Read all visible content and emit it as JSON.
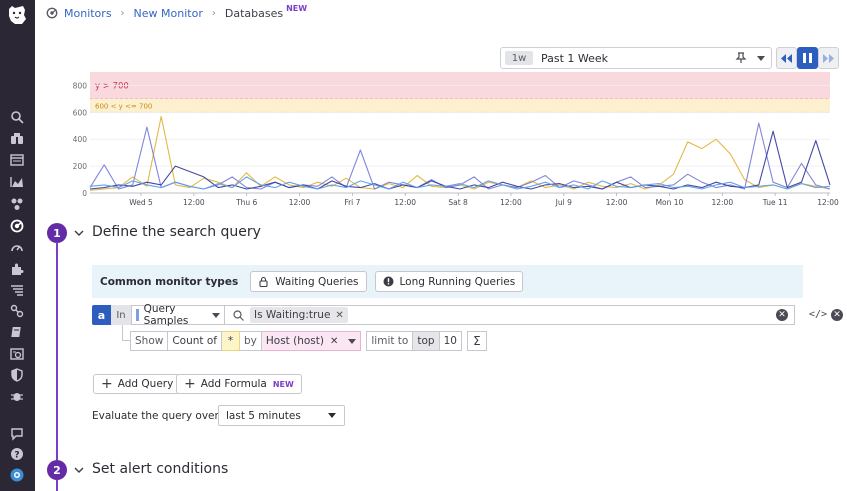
{
  "breadcrumb": {
    "items": [
      "Monitors",
      "New Monitor",
      "Databases"
    ],
    "new_badge": "NEW"
  },
  "time_selector": {
    "badge": "1w",
    "label": "Past 1 Week"
  },
  "chart_data": {
    "type": "line",
    "x_tick_labels": [
      "Wed 5",
      "12:00",
      "Thu 6",
      "12:00",
      "Fri 7",
      "12:00",
      "Sat 8",
      "12:00",
      "Jul 9",
      "12:00",
      "Mon 10",
      "12:00",
      "Tue 11",
      "12:00"
    ],
    "y_ticks": [
      0,
      200,
      400,
      600,
      800
    ],
    "ylim": [
      0,
      900
    ],
    "thresholds": [
      {
        "label": "y > 700",
        "from": 700,
        "to": 900,
        "color": "#f9d9de"
      },
      {
        "label": "600 < y <= 700",
        "from": 600,
        "to": 700,
        "color": "#fdf0cf"
      }
    ],
    "series": [
      {
        "color": "#e0b53a",
        "values": [
          20,
          30,
          40,
          120,
          50,
          570,
          60,
          40,
          110,
          80,
          40,
          150,
          50,
          120,
          60,
          40,
          80,
          50,
          110,
          40,
          30,
          70,
          40,
          130,
          50,
          40,
          60,
          30,
          80,
          60,
          40,
          90,
          40,
          60,
          30,
          80,
          50,
          40,
          70,
          30,
          60,
          140,
          380,
          330,
          400,
          290,
          100,
          40,
          60,
          30,
          70,
          50,
          30
        ]
      },
      {
        "color": "#7b80d8",
        "values": [
          40,
          210,
          30,
          60,
          490,
          40,
          80,
          50,
          30,
          60,
          120,
          40,
          30,
          80,
          40,
          60,
          50,
          120,
          40,
          320,
          30,
          80,
          60,
          40,
          100,
          40,
          60,
          120,
          30,
          60,
          40,
          80,
          130,
          40,
          90,
          60,
          30,
          80,
          120,
          40,
          50,
          60,
          140,
          80,
          40,
          60,
          30,
          520,
          80,
          40,
          220,
          60,
          30
        ]
      },
      {
        "color": "#3a3fa0",
        "values": [
          30,
          40,
          60,
          50,
          80,
          60,
          200,
          160,
          120,
          40,
          60,
          30,
          50,
          80,
          40,
          60,
          30,
          90,
          50,
          40,
          70,
          30,
          60,
          40,
          90,
          50,
          30,
          60,
          40,
          80,
          50,
          30,
          60,
          70,
          40,
          50,
          30,
          80,
          40,
          60,
          50,
          30,
          60,
          40,
          80,
          50,
          40,
          60,
          460,
          40,
          80,
          390,
          60
        ]
      },
      {
        "color": "#5ea0e8",
        "values": [
          50,
          60,
          40,
          90,
          60,
          40,
          80,
          50,
          30,
          70,
          40,
          120,
          60,
          40,
          80,
          50,
          30,
          60,
          40,
          90,
          60,
          30,
          80,
          40,
          60,
          50,
          70,
          40,
          90,
          60,
          30,
          50,
          80,
          40,
          60,
          30,
          90,
          50,
          40,
          60,
          70,
          40,
          50,
          30,
          60,
          80,
          40,
          50,
          60,
          30,
          70,
          40,
          50
        ]
      }
    ]
  },
  "step1": {
    "number": "1",
    "title": "Define the search query",
    "common_types_label": "Common monitor types",
    "common_types": [
      "Waiting Queries",
      "Long Running Queries"
    ],
    "query": {
      "letter": "a",
      "in_label": "In",
      "source": "Query Samples",
      "filter_tag": "Is Waiting:true",
      "code_icon": "</>"
    },
    "group": {
      "show": "Show",
      "count_of": "Count of",
      "star": "*",
      "by": "by",
      "group_tag": "Host (host)",
      "limit_to": "limit to",
      "top": "top",
      "limit": "10",
      "sigma": "Σ"
    },
    "add_query": "Add Query",
    "add_formula": "Add Formula",
    "add_formula_badge": "NEW",
    "evaluate_label": "Evaluate the query over the",
    "evaluate_value": "last 5 minutes"
  },
  "step2": {
    "number": "2",
    "title": "Set alert conditions"
  }
}
